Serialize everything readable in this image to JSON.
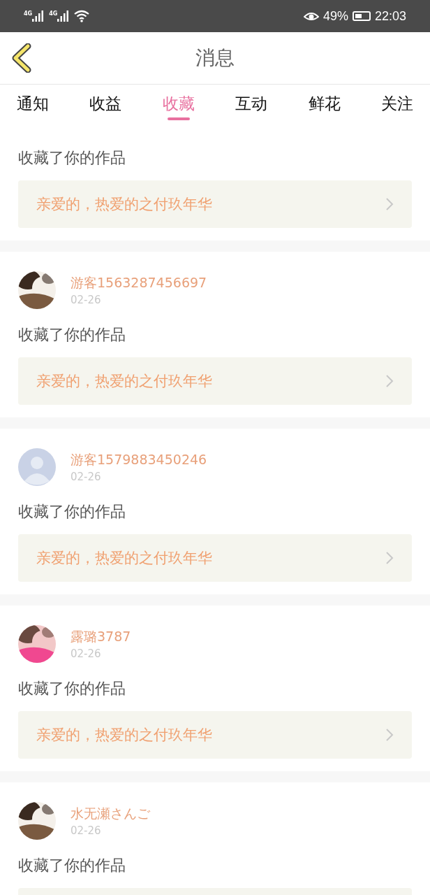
{
  "status_bar": {
    "networks": [
      "4G",
      "4G"
    ],
    "battery_text": "49%",
    "time": "22:03"
  },
  "header": {
    "title": "消息"
  },
  "tabs": [
    {
      "label": "通知",
      "selected": false
    },
    {
      "label": "收益",
      "selected": false
    },
    {
      "label": "收藏",
      "selected": true
    },
    {
      "label": "互动",
      "selected": false
    },
    {
      "label": "鲜花",
      "selected": false
    },
    {
      "label": "关注",
      "selected": false
    }
  ],
  "messages": [
    {
      "action": "收藏了你的作品",
      "work": "亲爱的，热爱的之付玖年华"
    },
    {
      "user": {
        "name": "游客1563287456697",
        "date": "02-26",
        "kind": "picture"
      },
      "action": "收藏了你的作品",
      "work": "亲爱的，热爱的之付玖年华"
    },
    {
      "user": {
        "name": "游客1579883450246",
        "date": "02-26",
        "kind": "default"
      },
      "action": "收藏了你的作品",
      "work": "亲爱的，热爱的之付玖年华"
    },
    {
      "user": {
        "name": "露璐3787",
        "date": "02-26",
        "kind": "picture"
      },
      "action": "收藏了你的作品",
      "work": "亲爱的，热爱的之付玖年华"
    },
    {
      "user": {
        "name": "水无瀬さんご",
        "date": "02-26",
        "kind": "picture"
      },
      "action": "收藏了你的作品"
    }
  ]
}
